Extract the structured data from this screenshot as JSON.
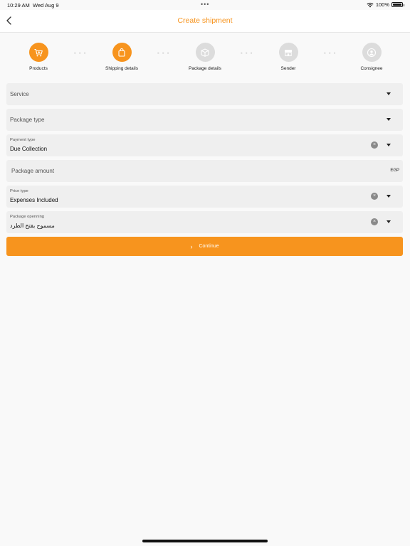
{
  "status_bar": {
    "time": "10:29 AM",
    "date": "Wed Aug 9",
    "multitask_dots": "•••",
    "battery_text": "100%"
  },
  "nav": {
    "title": "Create shipment",
    "back_icon": "chevron-left-icon"
  },
  "steps": [
    {
      "label": "Products",
      "icon": "cart-icon",
      "state": "active"
    },
    {
      "label": "Shipping details",
      "icon": "bag-icon",
      "state": "active"
    },
    {
      "label": "Package details",
      "icon": "box-icon",
      "state": "inactive"
    },
    {
      "label": "Sender",
      "icon": "store-icon",
      "state": "inactive"
    },
    {
      "label": "Consignee",
      "icon": "user-icon",
      "state": "inactive"
    }
  ],
  "step_connector": "- - -",
  "form": {
    "service": {
      "placeholder": "Service"
    },
    "package_type": {
      "placeholder": "Package type"
    },
    "payment_type": {
      "caption": "Payment type",
      "value": "Due Collection"
    },
    "package_amount": {
      "placeholder": "Package amount",
      "unit": "EGP"
    },
    "price_type": {
      "caption": "Price type",
      "value": "Expenses Included"
    },
    "package_opening": {
      "caption": "Package openning",
      "value": "مسموح بفتح الطرد"
    }
  },
  "clear_glyph": "×",
  "continue_button": {
    "label": "Continue",
    "chevron": "›"
  },
  "colors": {
    "accent": "#f7941e",
    "inactive_step": "#dcdcdc",
    "field_bg": "#efefef",
    "background": "#f9f9f9"
  }
}
